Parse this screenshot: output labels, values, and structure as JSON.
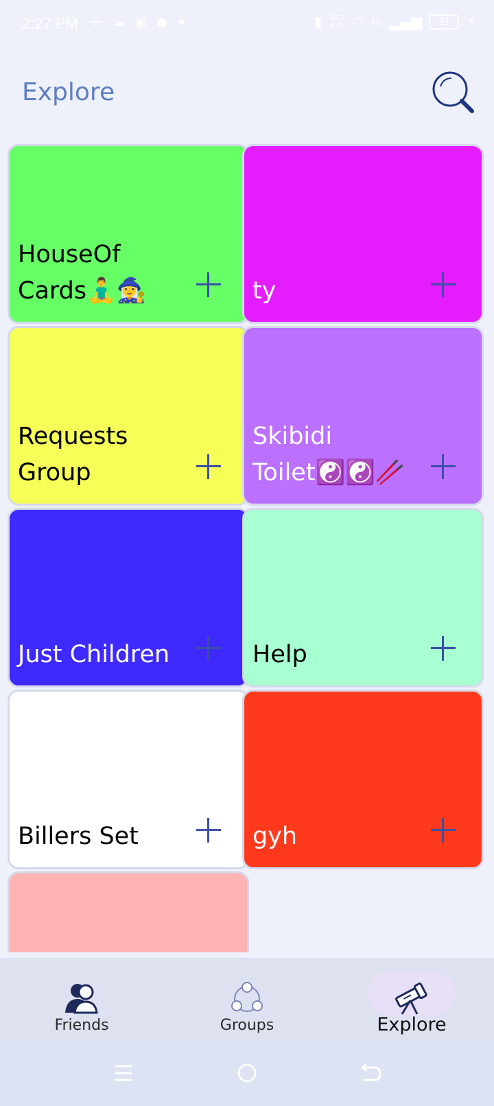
{
  "status_bar": {
    "time": "2:27 PM",
    "speed_value": "36.7",
    "speed_unit": "K/S",
    "network": "4G",
    "battery": "21"
  },
  "header": {
    "title": "Explore",
    "search_icon": "search-icon"
  },
  "groups": [
    {
      "title": "HouseOf Cards🧘‍♂️🧙‍♀️",
      "bg": "#66ff66",
      "text_color": "#000000"
    },
    {
      "title": "ty",
      "bg": "#e51cff",
      "text_color": "#ffffff"
    },
    {
      "title": "Requests Group",
      "bg": "#f5ff57",
      "text_color": "#000000"
    },
    {
      "title": "Skibidi Toilet☯️☯️🥢",
      "bg": "#bb70ff",
      "text_color": "#ffffff"
    },
    {
      "title": "Just Children",
      "bg": "#3e2aff",
      "text_color": "#ffffff"
    },
    {
      "title": "Help",
      "bg": "#a8ffd1",
      "text_color": "#000000"
    },
    {
      "title": "Billers Set",
      "bg": "#ffffff",
      "text_color": "#000000"
    },
    {
      "title": "gyh",
      "bg": "#ff3a1c",
      "text_color": "#ffffff"
    },
    {
      "title": "",
      "bg": "#ffb3b3",
      "text_color": "#000000"
    }
  ],
  "bottom_nav": {
    "items": [
      {
        "label": "Friends",
        "icon": "friends-icon"
      },
      {
        "label": "Groups",
        "icon": "groups-icon"
      },
      {
        "label": "Explore",
        "icon": "telescope-icon",
        "active": true
      }
    ]
  },
  "colors": {
    "accent": "#5f7fc3",
    "nav_bg": "#dde1f0",
    "add_icon": "#3c4fa8"
  }
}
